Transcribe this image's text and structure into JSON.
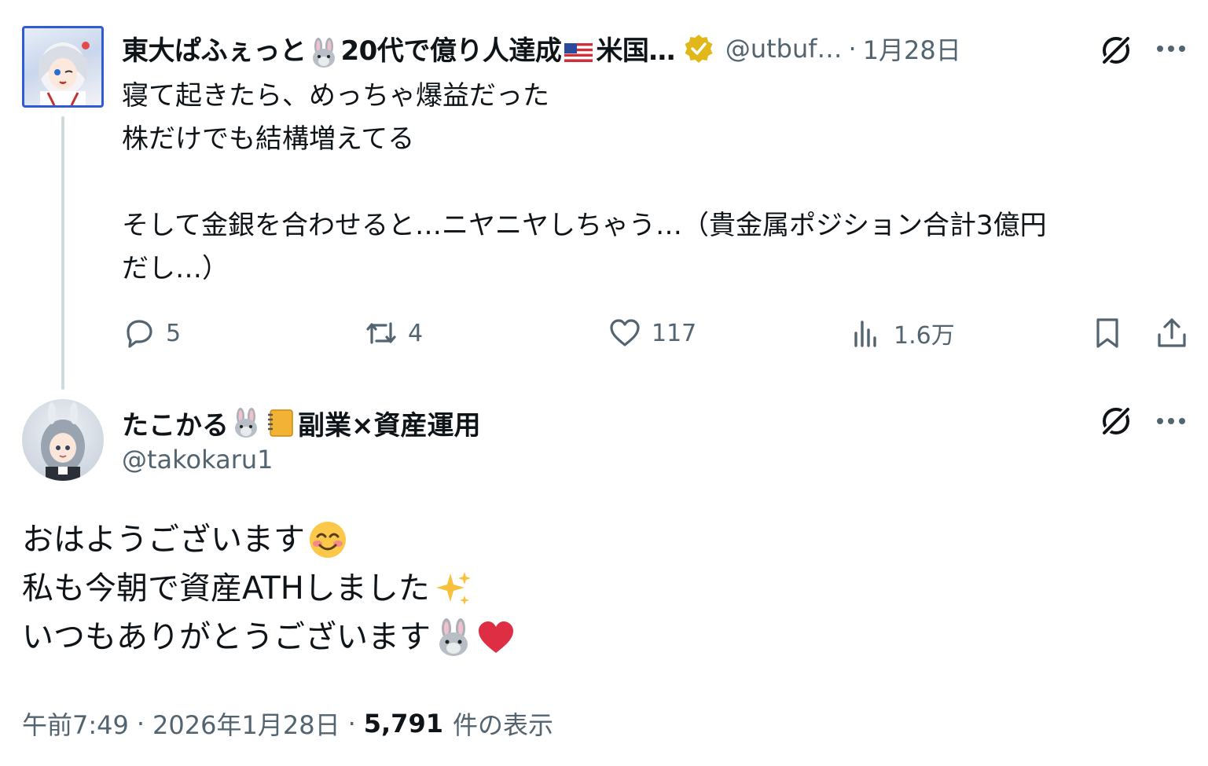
{
  "parent": {
    "name_part1": "東大ぱふぇっと",
    "name_part2": "20代で億り人達成",
    "name_part3": "米国…",
    "handle": "@utbuf…",
    "date": "1月28日",
    "text": "寝て起きたら、めっちゃ爆益だった\n株だけでも結構増えてる\n\nそして金銀を合わせると…ニヤニヤしちゃう…（貴金属ポジション合計3億円\nだし…）",
    "stats": {
      "replies": "5",
      "reposts": "4",
      "likes": "117",
      "views": "1.6万"
    }
  },
  "reply": {
    "name_part1": "たこかる",
    "name_part2": "副業×資産運用",
    "handle": "@takokaru1",
    "lines": [
      "おはようございます",
      "私も今朝で資産ATHしました",
      "いつもありがとうございます"
    ],
    "time": "午前7:49",
    "date": "2026年1月28日",
    "views_count": "5,791",
    "views_label": "件の表示"
  },
  "icons": {
    "verified": "verified-badge-icon",
    "grok": "grok-icon",
    "more": "more-icon",
    "reply": "reply-icon",
    "repost": "repost-icon",
    "like": "like-icon",
    "views": "views-icon",
    "bookmark": "bookmark-icon",
    "share": "share-icon"
  },
  "colors": {
    "text": "#0f1419",
    "secondary": "#536471",
    "thread_line": "#cfd9de",
    "verified_gold": "#e2b719"
  }
}
